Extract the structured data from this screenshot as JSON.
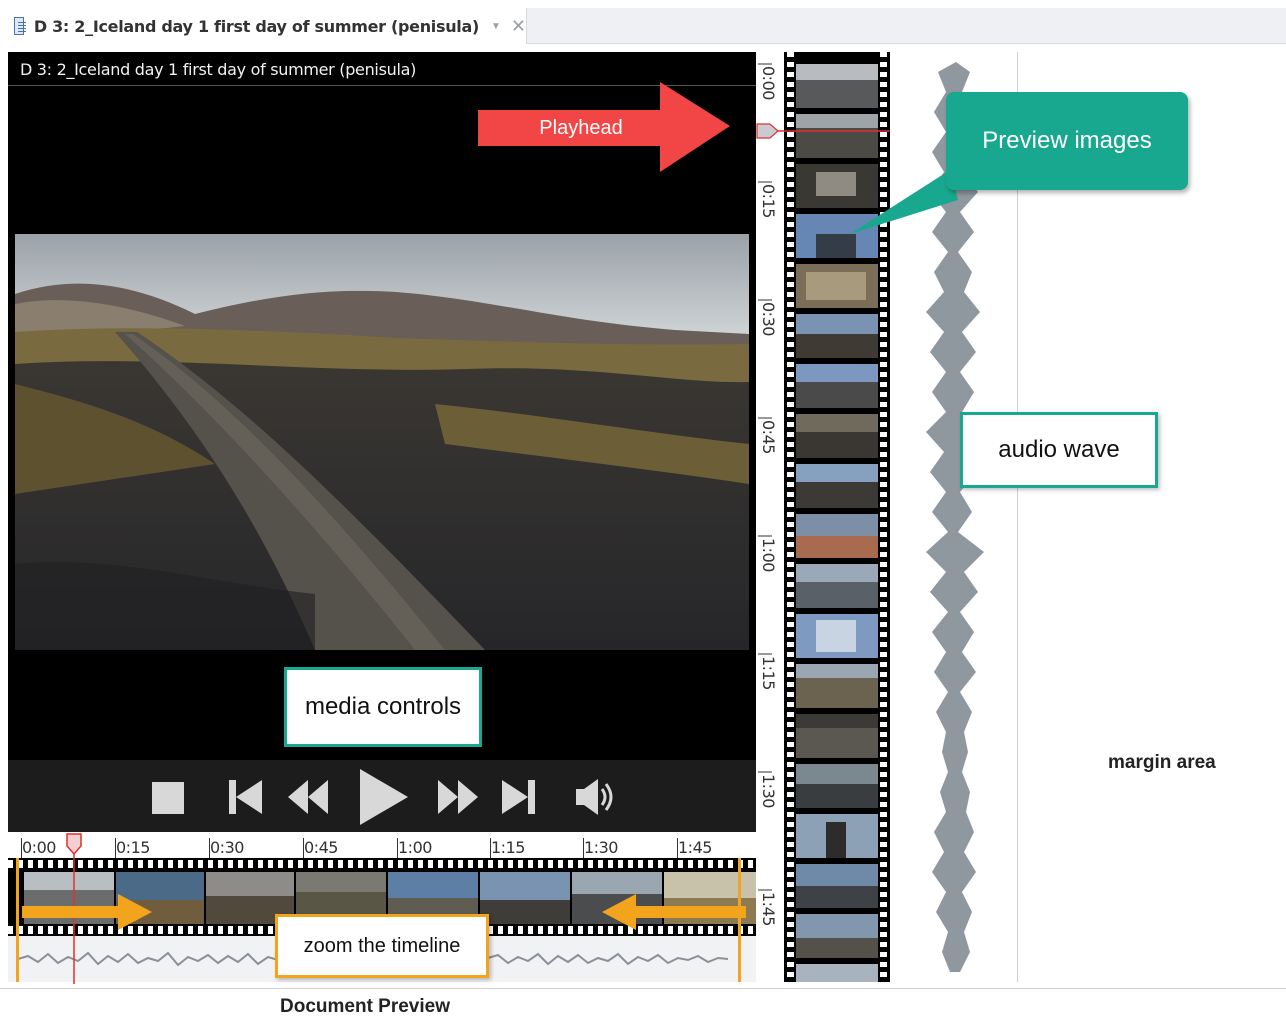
{
  "tab": {
    "title": "D 3: 2_Iceland day 1 first day of summer (penisula)",
    "pin_icon": "pin-dropdown-icon",
    "close_icon": "close-icon"
  },
  "video": {
    "title": "D 3: 2_Iceland day 1 first day of summer (penisula)"
  },
  "controls": {
    "items": [
      "stop-icon",
      "skip-to-start-icon",
      "rewind-icon",
      "play-icon",
      "fast-forward-icon",
      "skip-to-end-icon",
      "volume-icon"
    ]
  },
  "timeline": {
    "labels": [
      "0:00",
      "0:15",
      "0:30",
      "0:45",
      "1:00",
      "1:15",
      "1:30",
      "1:45"
    ]
  },
  "vertical_ruler": {
    "labels": [
      "0:00",
      "0:15",
      "0:30",
      "0:45",
      "1:00",
      "1:15",
      "1:30",
      "1:45"
    ]
  },
  "annotations": {
    "playhead": "Playhead",
    "preview_images": "Preview images",
    "audio_wave": "audio wave",
    "media_controls": "media controls",
    "zoom_timeline": "zoom the timeline",
    "margin_area": "margin area",
    "document_preview": "Document Preview"
  },
  "colors": {
    "teal": "#18a88f",
    "orange": "#f2a41c",
    "red": "#f24646",
    "playhead": "#e03030"
  }
}
